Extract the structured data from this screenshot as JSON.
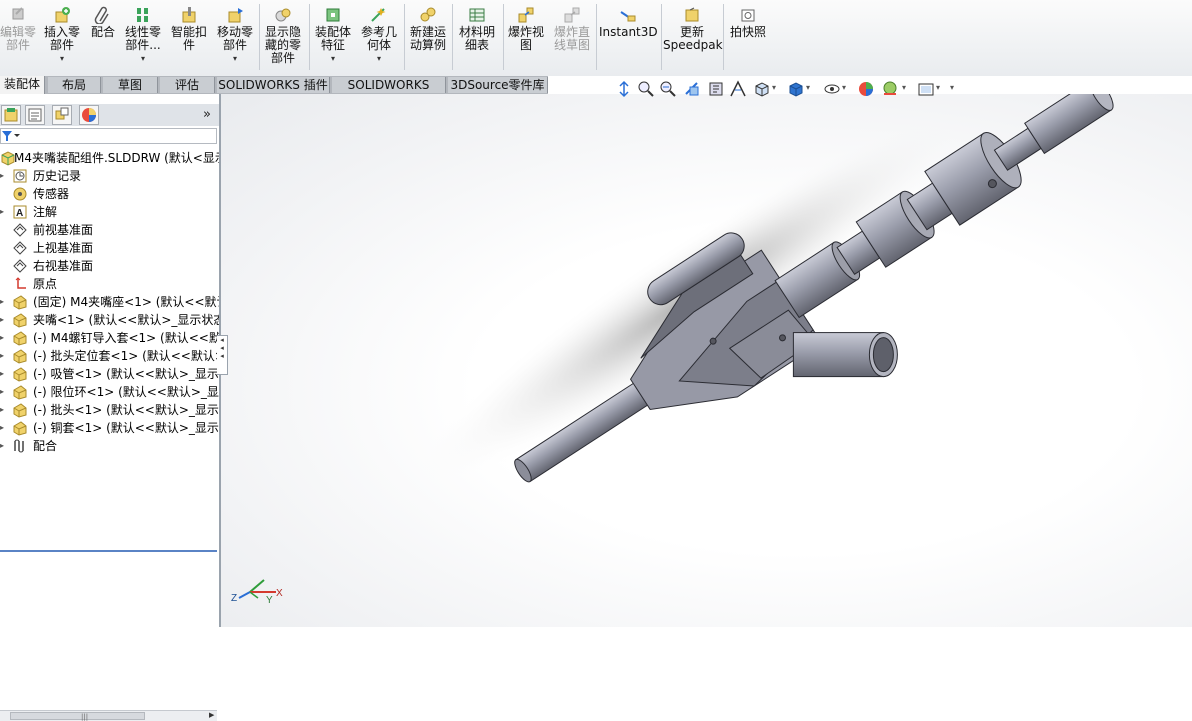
{
  "toolbar": {
    "items": [
      {
        "label": "编辑零\n部件",
        "disabled": true
      },
      {
        "label": "插入零\n部件",
        "dropdown": true
      },
      {
        "label": "配合"
      },
      {
        "label": "线性零\n部件...",
        "dropdown": true
      },
      {
        "label": "智能扣\n件"
      },
      {
        "label": "移动零\n部件",
        "dropdown": true
      },
      {
        "label": "显示隐\n藏的零\n部件"
      },
      {
        "label": "装配体\n特征",
        "dropdown": true
      },
      {
        "label": "参考几\n何体",
        "dropdown": true
      },
      {
        "label": "新建运\n动算例"
      },
      {
        "label": "材料明\n细表"
      },
      {
        "label": "爆炸视\n图"
      },
      {
        "label": "爆炸直\n线草图",
        "disabled": true
      },
      {
        "label": "Instant3D"
      },
      {
        "label": "更新\nSpeedpak"
      },
      {
        "label": "拍快照"
      }
    ]
  },
  "tabs": [
    {
      "label": "装配体",
      "active": true
    },
    {
      "label": "布局"
    },
    {
      "label": "草图"
    },
    {
      "label": "评估"
    },
    {
      "label": "SOLIDWORKS 插件"
    },
    {
      "label": "SOLIDWORKS MBD"
    },
    {
      "label": "3DSource零件库"
    }
  ],
  "panel": {
    "tabs": [
      "feature-manager",
      "property-manager",
      "configuration-manager",
      "display-manager"
    ],
    "more": "»"
  },
  "tree": [
    {
      "label": "M4夹嘴装配组件.SLDDRW  (默认<显示",
      "icon": "assembly-icon",
      "expand": false
    },
    {
      "label": "历史记录",
      "icon": "history-icon",
      "expand": true
    },
    {
      "label": "传感器",
      "icon": "sensor-icon",
      "expand": false
    },
    {
      "label": "注解",
      "icon": "annotation-icon",
      "expand": true
    },
    {
      "label": "前视基准面",
      "icon": "plane-icon",
      "expand": false
    },
    {
      "label": "上视基准面",
      "icon": "plane-icon",
      "expand": false
    },
    {
      "label": "右视基准面",
      "icon": "plane-icon",
      "expand": false
    },
    {
      "label": "原点",
      "icon": "origin-icon",
      "expand": false
    },
    {
      "label": "(固定) M4夹嘴座<1> (默认<<默认",
      "icon": "part-icon",
      "expand": true
    },
    {
      "label": "夹嘴<1> (默认<<默认>_显示状态",
      "icon": "part-icon",
      "expand": true
    },
    {
      "label": "(-) M4螺钉导入套<1> (默认<<默认",
      "icon": "part-icon",
      "expand": true
    },
    {
      "label": "(-) 批头定位套<1> (默认<<默认>",
      "icon": "part-icon",
      "expand": true
    },
    {
      "label": "(-) 吸管<1> (默认<<默认>_显示状",
      "icon": "part-icon",
      "expand": true
    },
    {
      "label": "(-) 限位环<1> (默认<<默认>_显示",
      "icon": "part-icon",
      "expand": true
    },
    {
      "label": "(-) 批头<1> (默认<<默认>_显示状",
      "icon": "part-icon",
      "expand": true
    },
    {
      "label": "(-) 铜套<1> (默认<<默认>_显示状",
      "icon": "part-icon",
      "expand": true
    },
    {
      "label": "配合",
      "icon": "mates-icon",
      "expand": true
    }
  ],
  "triad": {
    "x": "X",
    "y": "Y",
    "z": "Z"
  },
  "colors": {
    "model": "#8c8f9b",
    "accent": "#5a83c5",
    "panel_border": "#9aa3ad"
  }
}
